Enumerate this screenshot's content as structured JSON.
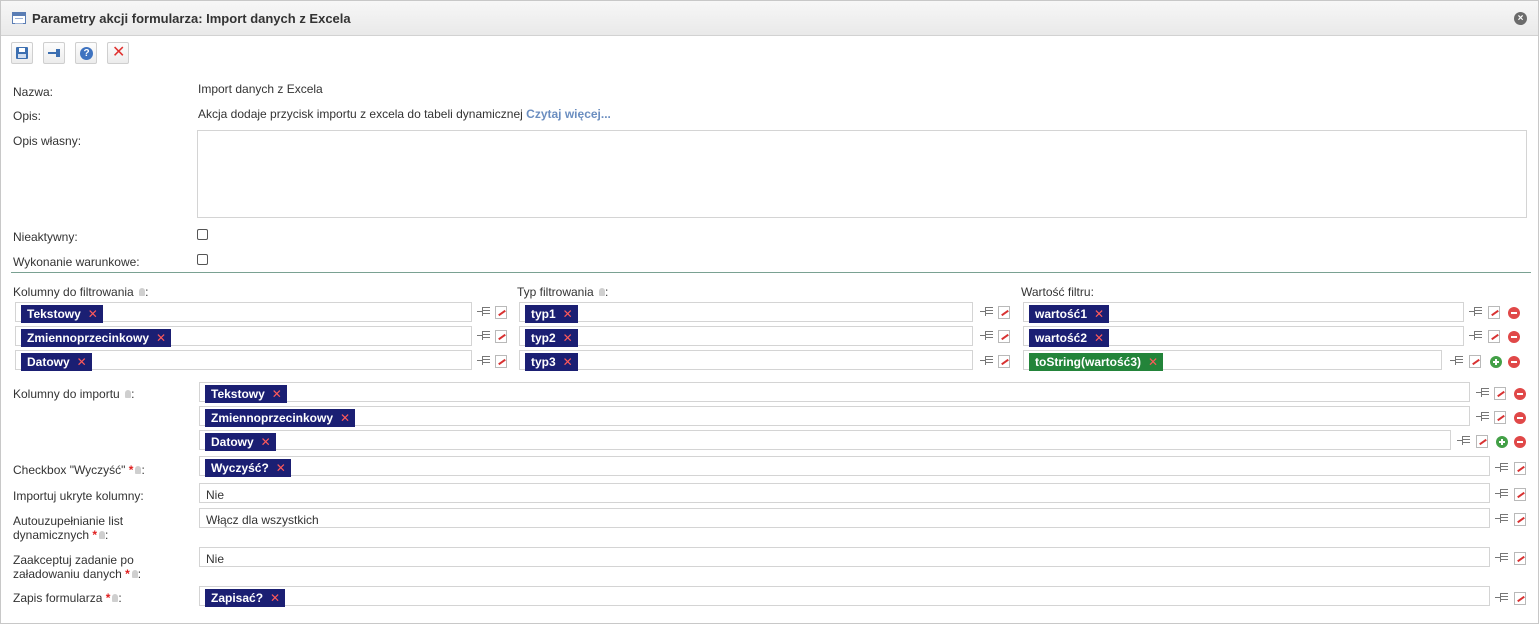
{
  "dialog": {
    "title": "Parametry akcji formularza: Import danych z Excela",
    "close_symbol": "×"
  },
  "toolbar": {
    "help_symbol": "?",
    "close_symbol": "✕"
  },
  "fields": {
    "name": {
      "label": "Nazwa:",
      "value": "Import danych z Excela"
    },
    "description": {
      "label": "Opis:",
      "value": "Akcja dodaje przycisk importu z excela do tabeli dynamicznej",
      "link": "Czytaj więcej..."
    },
    "own_description": {
      "label": "Opis własny:",
      "value": ""
    },
    "inactive": {
      "label": "Nieaktywny:",
      "checked": false
    },
    "conditional": {
      "label": "Wykonanie warunkowe:",
      "checked": false
    }
  },
  "filter": {
    "columns_label": "Kolumny do filtrowania",
    "type_label": "Typ filtrowania",
    "value_label": "Wartość filtru:",
    "label_suffix": ":",
    "columns": [
      "Tekstowy",
      "Zmiennoprzecinkowy",
      "Datowy"
    ],
    "types": [
      "typ1",
      "typ2",
      "typ3"
    ],
    "values": [
      "wartość1",
      "wartość2",
      "toString(wartość3)"
    ]
  },
  "import": {
    "label": "Kolumny do importu",
    "label_suffix": ":",
    "columns": [
      "Tekstowy",
      "Zmiennoprzecinkowy",
      "Datowy"
    ]
  },
  "options": {
    "clear_checkbox": {
      "label": "Checkbox \"Wyczyść\"",
      "suffix": ":",
      "value": "Wyczyść?"
    },
    "import_hidden": {
      "label": "Importuj ukryte kolumny:",
      "value": "Nie"
    },
    "autocomplete": {
      "label_line1": "Autouzupełnianie list",
      "label_line2": "dynamicznych",
      "suffix": ":",
      "value": "Włącz dla wszystkich"
    },
    "accept_task": {
      "label_line1": "Zaakceptuj zadanie po",
      "label_line2": "załadowaniu danych",
      "suffix": ":",
      "value": "Nie"
    },
    "form_save": {
      "label": "Zapis formularza",
      "suffix": ":",
      "value": "Zapisać?"
    }
  },
  "symbols": {
    "remove_tag": "✕",
    "required": "*"
  },
  "colors": {
    "tag_variable": "#1b1f73",
    "tag_expression": "#23843a",
    "divider": "#7aa192",
    "link": "#6b8ec0"
  }
}
